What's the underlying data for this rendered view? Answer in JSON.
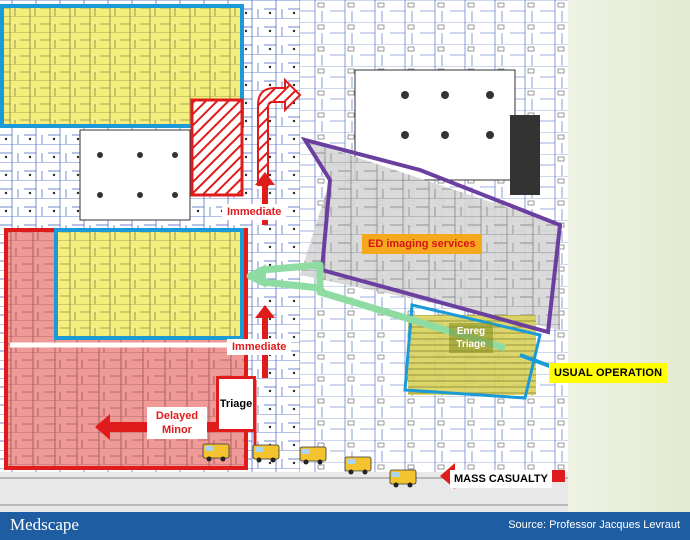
{
  "labels": {
    "immediate_top": "Immediate",
    "immediate_mid": "Immediate",
    "ed_imaging": "ED imaging services",
    "enreg_triage": "Enreg Triage",
    "delayed_minor": "Delayed Minor",
    "triage": "Triage",
    "usual_operation": "USUAL OPERATION",
    "mass_casualty": "MASS CASUALTY"
  },
  "footer": {
    "brand": "Medscape",
    "source": "Source: Professor Jacques Levraut"
  },
  "colors": {
    "yellow_zone": "#f4ef7c",
    "red_zone": "#f09a98",
    "blue_border": "#1a9ad6",
    "red_border": "#e01b1b",
    "purple_border": "#6b3fa0",
    "green_arrow": "#8fdca2",
    "orange_label": "#f5a81c",
    "footer_bg": "#1f5da3"
  },
  "icons": [
    "ambulance-icon",
    "arrow-icon"
  ]
}
